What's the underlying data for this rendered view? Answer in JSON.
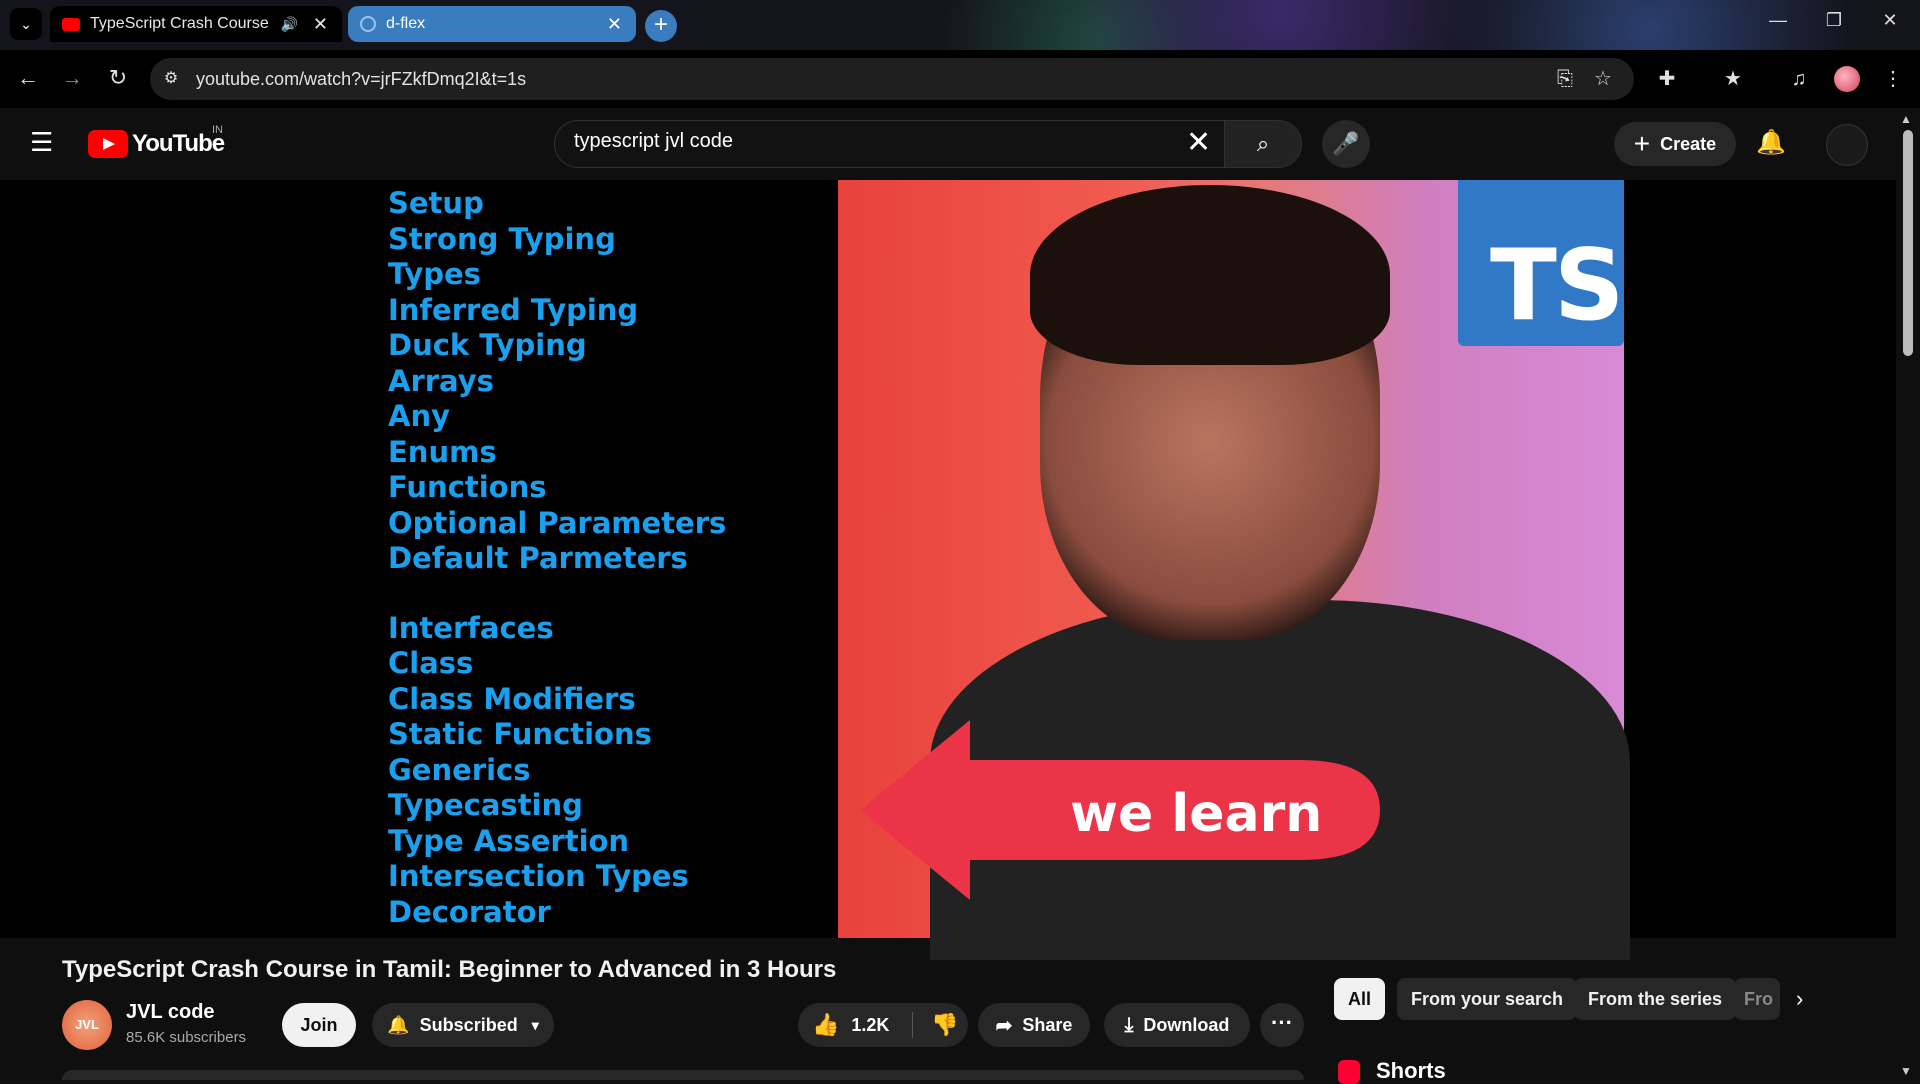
{
  "browser": {
    "tabs": [
      {
        "label": "TypeScript Crash Course in",
        "close": "✕",
        "audio": "🔊",
        "favicon": "youtube-icon"
      },
      {
        "label": "d-flex",
        "close": "✕",
        "favicon": "globe-icon"
      }
    ],
    "new_tab": "+",
    "tab_menu": "⌄",
    "url": "youtube.com/watch?v=jrFZkfDmq2I&t=1s",
    "window_controls": {
      "minimize": "—",
      "restore": "❐",
      "close": "✕"
    }
  },
  "youtube": {
    "logo_text": "YouTube",
    "country": "IN",
    "search": {
      "value": "typescript jvl code",
      "clear": "✕",
      "search_glyph": "⌕",
      "mic_glyph": "🎤"
    },
    "create_label": "Create",
    "create_plus": "+",
    "bell_glyph": "🔔"
  },
  "video": {
    "topics_group1": [
      "Setup",
      "Strong Typing",
      "Types",
      "Inferred Typing",
      "Duck Typing",
      "Arrays",
      "Any",
      "Enums",
      "Functions",
      "Optional Parameters",
      "Default Parmeters"
    ],
    "topics_group2": [
      "Interfaces",
      "Class",
      "Class Modifiers",
      "Static Functions",
      "Generics",
      "Typecasting",
      "Type Assertion",
      "Intersection Types",
      "Decorator"
    ],
    "ts_logo": "TS",
    "arrow_text": "we learn"
  },
  "details": {
    "title": "TypeScript Crash Course in Tamil: Beginner to Advanced in 3 Hours",
    "channel_avatar_text": "JVL",
    "channel": "JVL code",
    "subscribers": "85.6K subscribers",
    "join": "Join",
    "subscribed": "Subscribed",
    "likes": "1.2K",
    "share": "Share",
    "download": "Download",
    "more": "···"
  },
  "chips": [
    "All",
    "From your search",
    "From the series",
    "Fro"
  ],
  "shorts_label": "Shorts",
  "colors": {
    "accent": "#1aa0ef",
    "youtube_red": "#ff0000",
    "ts_blue": "#3178c6",
    "arrow_red": "#ec3448"
  }
}
